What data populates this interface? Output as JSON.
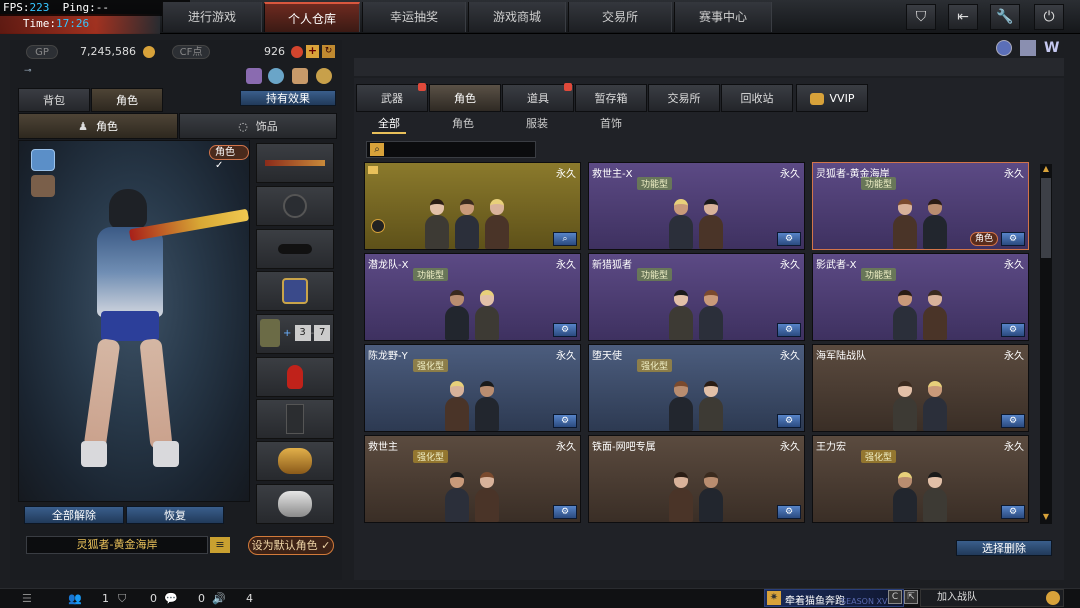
{
  "debug": {
    "fps_label": "FPS:",
    "fps_value": "223",
    "ping_label": "Ping:",
    "ping_value": "--",
    "time_label": "Time:",
    "time_value": "17:26"
  },
  "nav": {
    "tabs": [
      "进行游戏",
      "个人仓库",
      "幸运抽奖",
      "游戏商城",
      "交易所",
      "赛事中心"
    ],
    "active": "个人仓库"
  },
  "currency": {
    "gp_label": "GP",
    "gp_value": "7,245,586",
    "cf_label": "CF点",
    "cf_value": "926"
  },
  "left": {
    "tabs": [
      "背包",
      "角色"
    ],
    "active_tab": "角色",
    "holdings_button": "持有效果",
    "sub_tabs": [
      "角色",
      "饰品"
    ],
    "role_badge": "角色",
    "unequip_all": "全部解除",
    "restore": "恢复",
    "character_name": "灵狐者-黄金海岸",
    "set_default": "设为默认角色"
  },
  "right": {
    "tabs": [
      "武器",
      "角色",
      "道具",
      "暂存箱",
      "交易所",
      "回收站",
      "VVIP"
    ],
    "active_tab": "角色",
    "sub_tabs": [
      "全部",
      "角色",
      "服装",
      "首饰"
    ],
    "active_sub_tab": "全部",
    "search_placeholder": "",
    "select_delete": "选择删除",
    "cards": [
      {
        "name": "",
        "duration": "永久",
        "tag": "",
        "theme": "gold",
        "chip": ""
      },
      {
        "name": "救世主-X",
        "duration": "永久",
        "tag": "功能型",
        "theme": "purple",
        "chip": ""
      },
      {
        "name": "灵狐者-黄金海岸",
        "duration": "永久",
        "tag": "功能型",
        "theme": "purple",
        "chip": "角色"
      },
      {
        "name": "潜龙队-X",
        "duration": "永久",
        "tag": "功能型",
        "theme": "purple",
        "chip": ""
      },
      {
        "name": "新猎狐者",
        "duration": "永久",
        "tag": "功能型",
        "theme": "purple",
        "chip": ""
      },
      {
        "name": "影武者-X",
        "duration": "永久",
        "tag": "功能型",
        "theme": "purple",
        "chip": ""
      },
      {
        "name": "陈龙野-Y",
        "duration": "永久",
        "tag": "强化型",
        "theme": "blue",
        "chip": ""
      },
      {
        "name": "堕天使",
        "duration": "永久",
        "tag": "强化型",
        "theme": "blue",
        "chip": ""
      },
      {
        "name": "海军陆战队",
        "duration": "永久",
        "tag": "",
        "theme": "brown",
        "chip": ""
      },
      {
        "name": "救世主",
        "duration": "永久",
        "tag": "强化型",
        "theme": "brown",
        "chip": ""
      },
      {
        "name": "铁面-网吧专属",
        "duration": "永久",
        "tag": "",
        "theme": "brown",
        "chip": ""
      },
      {
        "name": "王力宏",
        "duration": "永久",
        "tag": "强化型",
        "theme": "brown",
        "chip": ""
      }
    ]
  },
  "bottom": {
    "count_1": "1",
    "count_2": "0",
    "count_3": "0",
    "count_4": "4",
    "notice": "牵着猫鱼奔跑",
    "season": "SEASON XVII",
    "join_team": "加入战队"
  }
}
